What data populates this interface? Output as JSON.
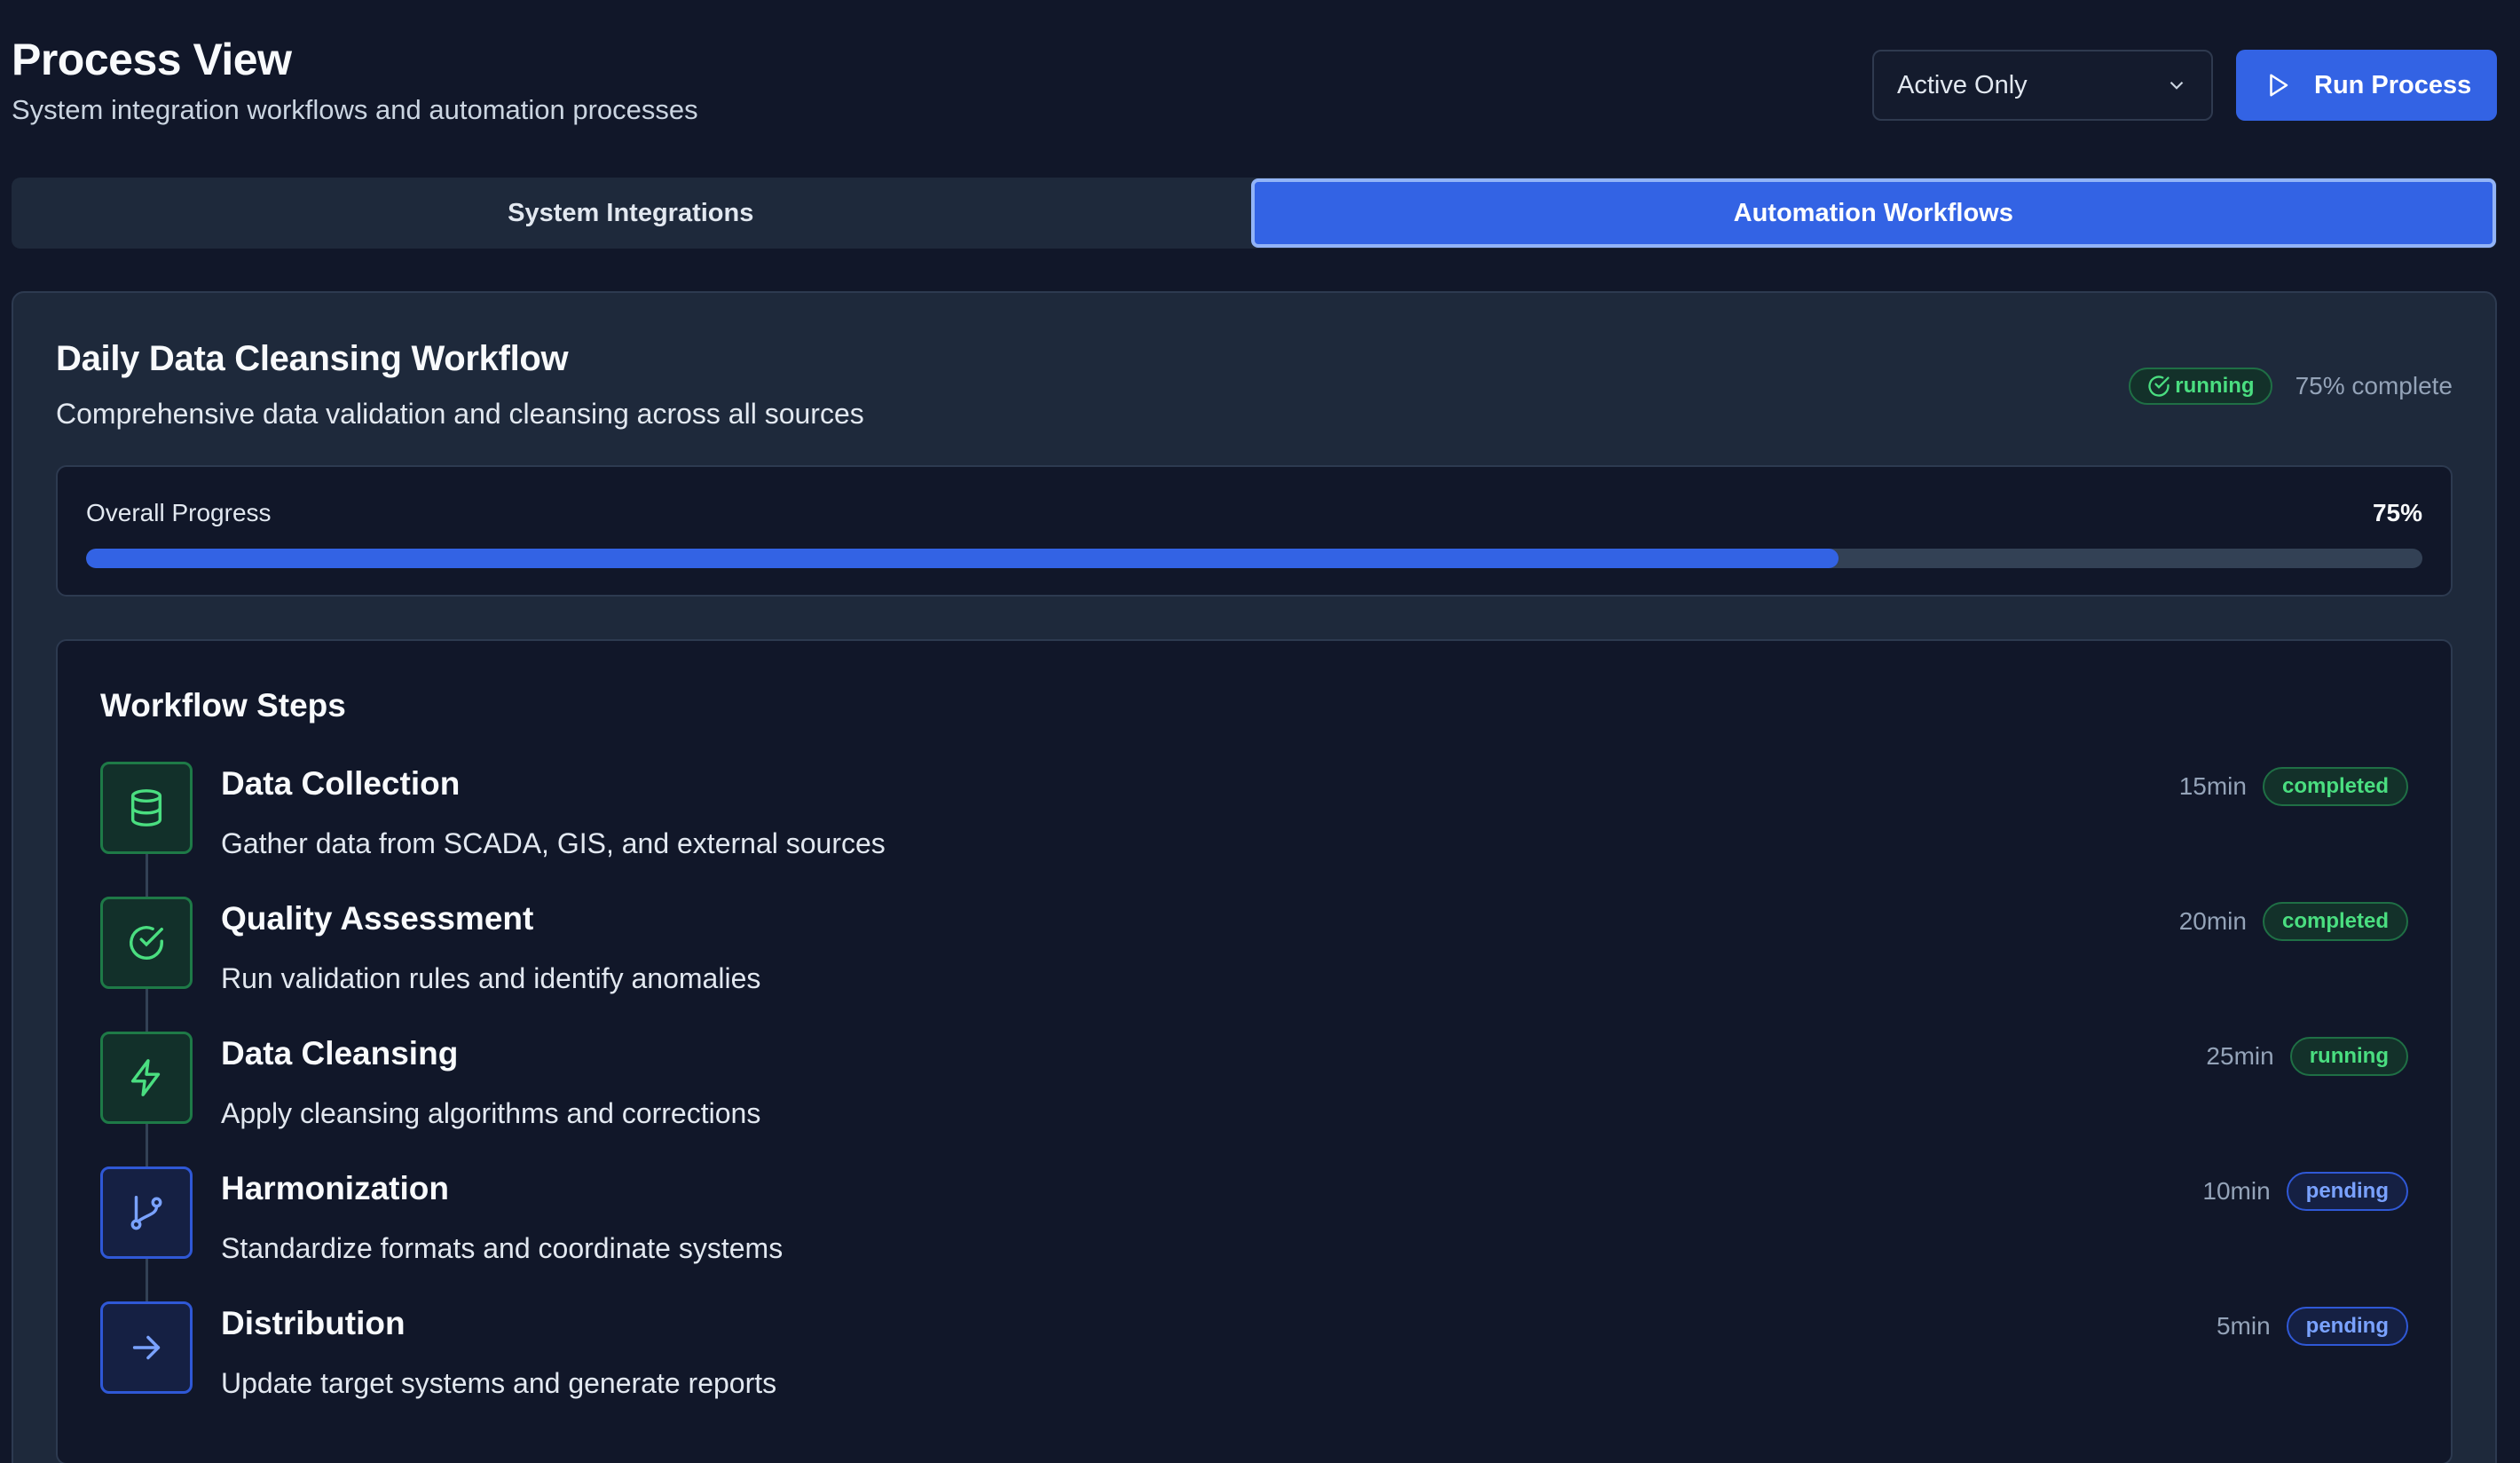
{
  "header": {
    "title": "Process View",
    "subtitle": "System integration workflows and automation processes",
    "filter_value": "Active Only",
    "run_label": "Run Process"
  },
  "tabs": [
    {
      "label": "System Integrations",
      "active": false
    },
    {
      "label": "Automation Workflows",
      "active": true
    }
  ],
  "workflow": {
    "title": "Daily Data Cleansing Workflow",
    "description": "Comprehensive data validation and cleansing across all sources",
    "status": "running",
    "complete_text": "75% complete",
    "progress_label": "Overall Progress",
    "progress_value": 75,
    "progress_text": "75%"
  },
  "steps_title": "Workflow Steps",
  "steps": [
    {
      "name": "Data Collection",
      "description": "Gather data from SCADA, GIS, and external sources",
      "duration": "15min",
      "status": "completed",
      "icon": "database-icon"
    },
    {
      "name": "Quality Assessment",
      "description": "Run validation rules and identify anomalies",
      "duration": "20min",
      "status": "completed",
      "icon": "check-circle-icon"
    },
    {
      "name": "Data Cleansing",
      "description": "Apply cleansing algorithms and corrections",
      "duration": "25min",
      "status": "running",
      "icon": "lightning-icon"
    },
    {
      "name": "Harmonization",
      "description": "Standardize formats and coordinate systems",
      "duration": "10min",
      "status": "pending",
      "icon": "git-branch-icon"
    },
    {
      "name": "Distribution",
      "description": "Update target systems and generate reports",
      "duration": "5min",
      "status": "pending",
      "icon": "arrow-right-icon"
    }
  ],
  "colors": {
    "accent": "#3363e4",
    "success": "#4ade80",
    "pending": "#7aa2ff",
    "background": "#111729"
  }
}
